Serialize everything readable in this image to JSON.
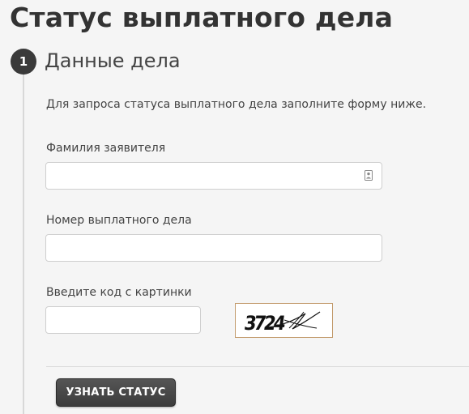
{
  "page": {
    "title": "Статус выплатного дела"
  },
  "step": {
    "number": "1",
    "title": "Данные дела"
  },
  "form": {
    "intro": "Для запроса статуса выплатного дела заполните форму ниже.",
    "applicant_surname": {
      "label": "Фамилия заявителя",
      "value": "",
      "icon": "contact-card-icon"
    },
    "case_number": {
      "label": "Номер выплатного дела",
      "value": ""
    },
    "captcha_code": {
      "label": "Введите код с картинки",
      "value": "",
      "image_text": "3724"
    },
    "submit_label": "УЗНАТЬ СТАТУС"
  },
  "colors": {
    "background": "#f5f5f5",
    "text": "#444444",
    "step_badge": "#3a3a3a",
    "button": "#484848",
    "input_border": "#cfcfcf",
    "captcha_border": "#c29a6c"
  }
}
